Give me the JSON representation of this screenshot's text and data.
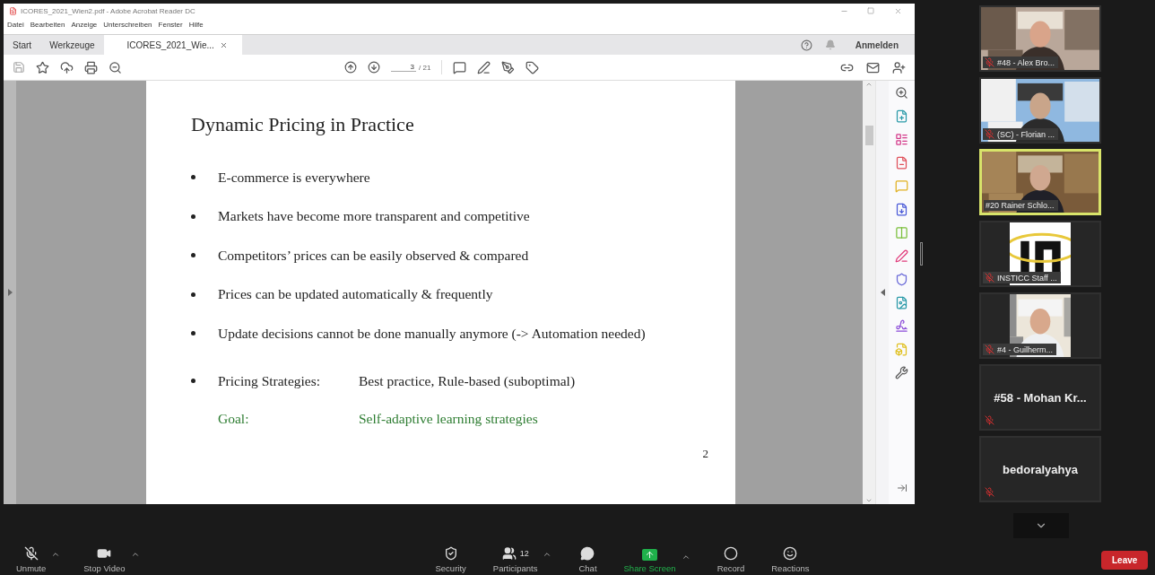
{
  "window": {
    "title": "ICORES_2021_Wien2.pdf - Adobe Acrobat Reader DC"
  },
  "menu": [
    "Datei",
    "Bearbeiten",
    "Anzeige",
    "Unterschreiben",
    "Fenster",
    "Hilfe"
  ],
  "tabs": [
    {
      "label": "Start",
      "selected": false
    },
    {
      "label": "Werkzeuge",
      "selected": false
    },
    {
      "label": "ICORES_2021_Wie...",
      "selected": true
    }
  ],
  "account": {
    "label": "Anmelden"
  },
  "pager": {
    "page": "3",
    "total": "/ 21"
  },
  "slide": {
    "title": "Dynamic Pricing in Practice",
    "bullets": [
      "E-commerce is everywhere",
      "Markets have become more transparent and competitive",
      "Competitors’ prices can be easily observed & compared",
      "Prices can be updated automatically & frequently",
      "Update decisions cannot be done manually anymore (-> Automation needed)"
    ],
    "strategy": {
      "label": "Pricing Strategies:",
      "value": "Best practice, Rule-based  (suboptimal)"
    },
    "goal": {
      "label": "Goal:",
      "value": "Self-adaptive learning strategies"
    },
    "page_number": "2"
  },
  "gallery": [
    {
      "kind": "video",
      "name": "#48 - Alex Bro...",
      "muted": true,
      "speaking": false
    },
    {
      "kind": "video",
      "name": "(SC) - Florian ...",
      "muted": true,
      "speaking": false
    },
    {
      "kind": "video",
      "name": "#20 Rainer Schlo...",
      "muted": false,
      "speaking": true
    },
    {
      "name": "INSTICC Staff ...",
      "muted": true,
      "speaking": false
    },
    {
      "name": "#4 - Guilherm...",
      "muted": true,
      "speaking": false
    },
    {
      "kind": "name",
      "name": "#58 - Mohan Kr...",
      "muted": true,
      "speaking": false
    },
    {
      "kind": "name",
      "name": "bedoralyahya",
      "muted": true,
      "speaking": false
    }
  ],
  "controls": [
    {
      "kind": "mic",
      "label": "Unmute",
      "caret": true
    },
    {
      "kind": "video",
      "label": "Stop Video",
      "caret": true
    },
    {
      "kind": "security",
      "label": "Security",
      "caret": false
    },
    {
      "kind": "participants",
      "label": "Participants",
      "count": "12",
      "caret": true
    },
    {
      "kind": "chat",
      "label": "Chat",
      "caret": false
    },
    {
      "kind": "share",
      "label": "Share Screen",
      "caret": true
    },
    {
      "kind": "record",
      "label": "Record",
      "caret": false
    },
    {
      "kind": "reactions",
      "label": "Reactions",
      "caret": false
    }
  ],
  "leave": {
    "label": "Leave"
  }
}
